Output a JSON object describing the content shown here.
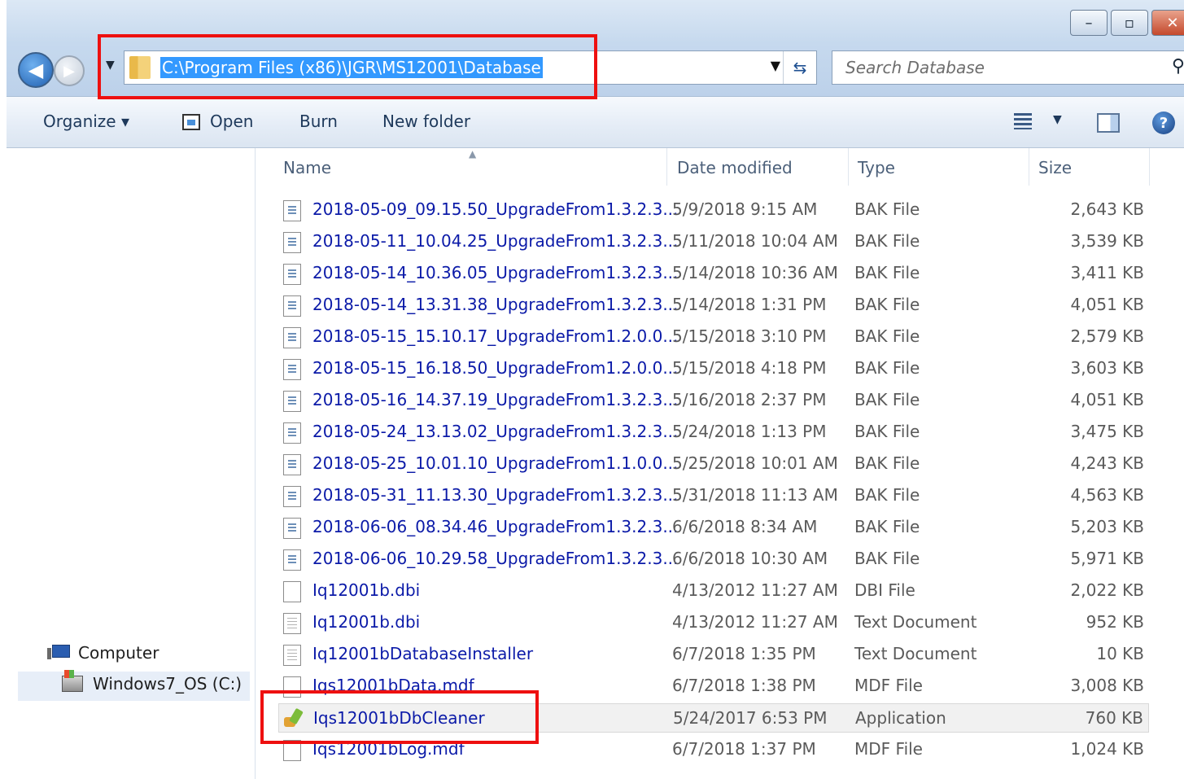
{
  "window": {
    "caption_buttons": {
      "minimize": "–",
      "maximize": "▫",
      "close": "✕"
    }
  },
  "address_bar": {
    "path": "C:\\Program Files (x86)\\JGR\\MS12001\\Database",
    "search_placeholder": "Search Database"
  },
  "toolbar": {
    "organize": "Organize ▾",
    "open": "Open",
    "burn": "Burn",
    "new_folder": "New folder"
  },
  "nav": {
    "computer": "Computer",
    "drive": "Windows7_OS (C:)"
  },
  "columns": {
    "name": "Name",
    "date": "Date modified",
    "type": "Type",
    "size": "Size"
  },
  "files": [
    {
      "name": "2018-05-09_09.15.50_UpgradeFrom1.3.2.3...",
      "date": "5/9/2018 9:15 AM",
      "type": "BAK File",
      "size": "2,643 KB",
      "icon": "bak-file-icon"
    },
    {
      "name": "2018-05-11_10.04.25_UpgradeFrom1.3.2.3...",
      "date": "5/11/2018 10:04 AM",
      "type": "BAK File",
      "size": "3,539 KB",
      "icon": "bak-file-icon"
    },
    {
      "name": "2018-05-14_10.36.05_UpgradeFrom1.3.2.3...",
      "date": "5/14/2018 10:36 AM",
      "type": "BAK File",
      "size": "3,411 KB",
      "icon": "bak-file-icon"
    },
    {
      "name": "2018-05-14_13.31.38_UpgradeFrom1.3.2.3...",
      "date": "5/14/2018 1:31 PM",
      "type": "BAK File",
      "size": "4,051 KB",
      "icon": "bak-file-icon"
    },
    {
      "name": "2018-05-15_15.10.17_UpgradeFrom1.2.0.0...",
      "date": "5/15/2018 3:10 PM",
      "type": "BAK File",
      "size": "2,579 KB",
      "icon": "bak-file-icon"
    },
    {
      "name": "2018-05-15_16.18.50_UpgradeFrom1.2.0.0...",
      "date": "5/15/2018 4:18 PM",
      "type": "BAK File",
      "size": "3,603 KB",
      "icon": "bak-file-icon"
    },
    {
      "name": "2018-05-16_14.37.19_UpgradeFrom1.3.2.3...",
      "date": "5/16/2018 2:37 PM",
      "type": "BAK File",
      "size": "4,051 KB",
      "icon": "bak-file-icon"
    },
    {
      "name": "2018-05-24_13.13.02_UpgradeFrom1.3.2.3...",
      "date": "5/24/2018 1:13 PM",
      "type": "BAK File",
      "size": "3,475 KB",
      "icon": "bak-file-icon"
    },
    {
      "name": "2018-05-25_10.01.10_UpgradeFrom1.1.0.0...",
      "date": "5/25/2018 10:01 AM",
      "type": "BAK File",
      "size": "4,243 KB",
      "icon": "bak-file-icon"
    },
    {
      "name": "2018-05-31_11.13.30_UpgradeFrom1.3.2.3...",
      "date": "5/31/2018 11:13 AM",
      "type": "BAK File",
      "size": "4,563 KB",
      "icon": "bak-file-icon"
    },
    {
      "name": "2018-06-06_08.34.46_UpgradeFrom1.3.2.3...",
      "date": "6/6/2018 8:34 AM",
      "type": "BAK File",
      "size": "5,203 KB",
      "icon": "bak-file-icon"
    },
    {
      "name": "2018-06-06_10.29.58_UpgradeFrom1.3.2.3...",
      "date": "6/6/2018 10:30 AM",
      "type": "BAK File",
      "size": "5,971 KB",
      "icon": "bak-file-icon"
    },
    {
      "name": "Iq12001b.dbi",
      "date": "4/13/2012 11:27 AM",
      "type": "DBI File",
      "size": "2,022 KB",
      "icon": "blank-file-icon"
    },
    {
      "name": "Iq12001b.dbi",
      "date": "4/13/2012 11:27 AM",
      "type": "Text Document",
      "size": "952 KB",
      "icon": "text-document-icon"
    },
    {
      "name": "Iq12001bDatabaseInstaller",
      "date": "6/7/2018 1:35 PM",
      "type": "Text Document",
      "size": "10 KB",
      "icon": "text-document-icon"
    },
    {
      "name": "Iqs12001bData.mdf",
      "date": "6/7/2018 1:38 PM",
      "type": "MDF File",
      "size": "3,008 KB",
      "icon": "blank-file-icon"
    },
    {
      "name": "Iqs12001bDbCleaner",
      "date": "5/24/2017 6:53 PM",
      "type": "Application",
      "size": "760 KB",
      "icon": "application-icon"
    },
    {
      "name": "Iqs12001bLog.mdf",
      "date": "6/7/2018 1:37 PM",
      "type": "MDF File",
      "size": "1,024 KB",
      "icon": "blank-file-icon"
    }
  ],
  "colors": {
    "selection": "#3399ff",
    "link_text": "#0b1aa8",
    "annotation_red": "#ee1010"
  }
}
